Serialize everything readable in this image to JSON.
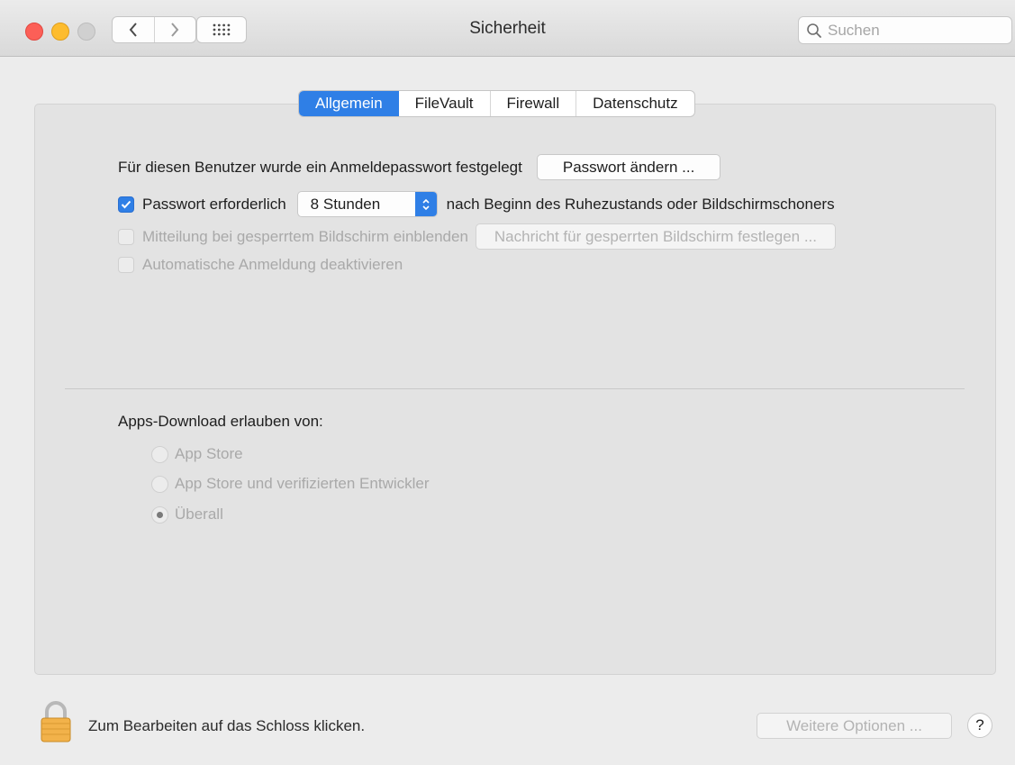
{
  "window": {
    "title": "Sicherheit"
  },
  "search": {
    "placeholder": "Suchen"
  },
  "tabs": [
    {
      "label": "Allgemein",
      "active": true
    },
    {
      "label": "FileVault",
      "active": false
    },
    {
      "label": "Firewall",
      "active": false
    },
    {
      "label": "Datenschutz",
      "active": false
    }
  ],
  "general": {
    "password_set_text": "Für diesen Benutzer wurde ein Anmeldepasswort festgelegt",
    "change_password_button": "Passwort ändern ...",
    "require_password": {
      "label": "Passwort erforderlich",
      "checked": true,
      "selected_value": "8 Stunden",
      "suffix": "nach Beginn des Ruhezustands oder Bildschirmschoners"
    },
    "lock_message": {
      "label": "Mitteilung bei gesperrtem Bildschirm einblenden",
      "checked": false,
      "enabled": false,
      "button": "Nachricht für gesperrten Bildschirm festlegen ..."
    },
    "auto_login": {
      "label": "Automatische Anmeldung deaktivieren",
      "checked": false,
      "enabled": false
    }
  },
  "downloads": {
    "heading": "Apps-Download erlauben von:",
    "options": [
      {
        "label": "App Store",
        "selected": false
      },
      {
        "label": "App Store und verifizierten Entwickler",
        "selected": false
      },
      {
        "label": "Überall",
        "selected": true
      }
    ]
  },
  "footer": {
    "lock_text": "Zum Bearbeiten auf das Schloss klicken.",
    "more_options_button": "Weitere Optionen ...",
    "help_label": "?"
  },
  "colors": {
    "accent": "#2f7fe6",
    "close": "#fc5f57",
    "minimize": "#fdbc2e",
    "lock": "#f2b24a"
  },
  "icons": [
    "back-arrow-icon",
    "forward-arrow-icon",
    "grid-icon",
    "search-icon",
    "checkmark-icon",
    "popup-arrows-icon",
    "lock-icon"
  ]
}
